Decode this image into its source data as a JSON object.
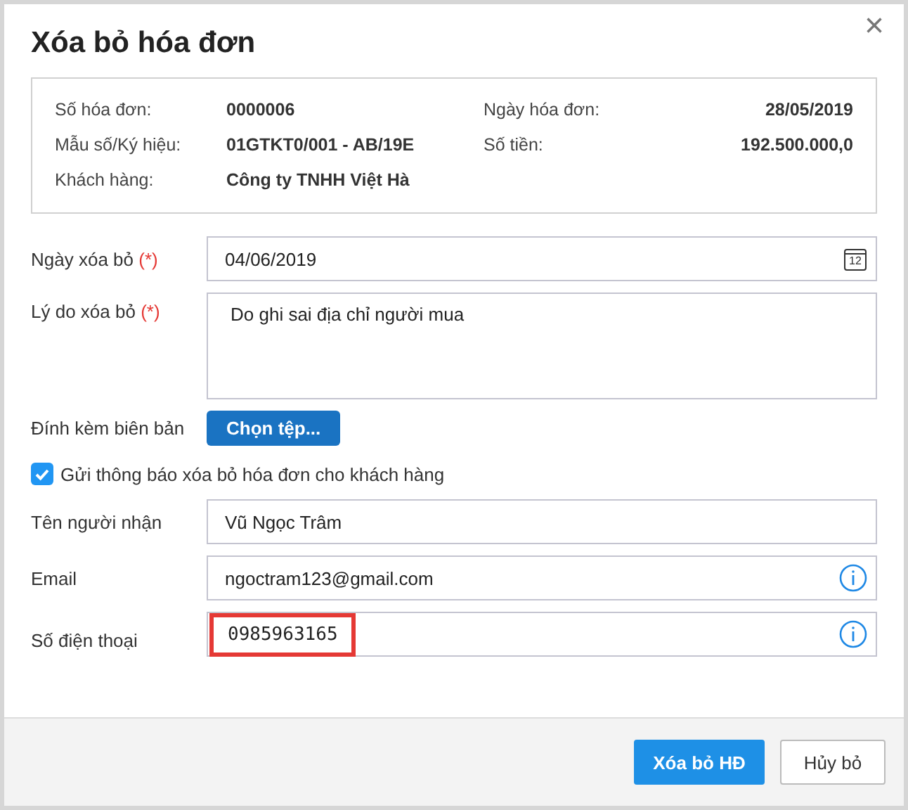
{
  "dialog": {
    "title": "Xóa bỏ hóa đơn",
    "close": "×"
  },
  "invoice_info": [
    {
      "label": "Số hóa đơn:",
      "value": "0000006"
    },
    {
      "label": "Ngày hóa đơn:",
      "value": "28/05/2019"
    },
    {
      "label": "Mẫu số/Ký hiệu:",
      "value": "01GTKT0/001 - AB/19E"
    },
    {
      "label": "Số tiền:",
      "value": "192.500.000,0"
    },
    {
      "label": "Khách hàng:",
      "value": "Công ty TNHH Việt Hà"
    }
  ],
  "fields": [
    {
      "kind": "date",
      "label": "Ngày xóa bỏ",
      "required_mark": "(*)",
      "value": "04/06/2019",
      "calendar_day": "12"
    },
    {
      "kind": "textarea",
      "label": "Lý do xóa bỏ",
      "required_mark": "(*)",
      "value": "Do ghi sai địa chỉ người mua"
    },
    {
      "kind": "file",
      "label": "Đính kèm biên bản",
      "button": "Chọn tệp..."
    }
  ],
  "notify": {
    "label": "Gửi thông báo xóa bỏ hóa đơn cho khách hàng",
    "checked": true
  },
  "recipient_fields": [
    {
      "kind": "text",
      "label": "Tên người nhận",
      "value": "Vũ Ngọc Trâm",
      "info": false,
      "highlighted": false
    },
    {
      "kind": "text",
      "label": "Email",
      "value": "ngoctram123@gmail.com",
      "info": true,
      "highlighted": false
    },
    {
      "kind": "text",
      "label": "Số điện thoại",
      "value": "0985963165",
      "info": true,
      "highlighted": true
    }
  ],
  "buttons": [
    {
      "label": "Xóa bỏ HĐ",
      "primary": true
    },
    {
      "label": "Hủy bỏ",
      "primary": false
    }
  ]
}
